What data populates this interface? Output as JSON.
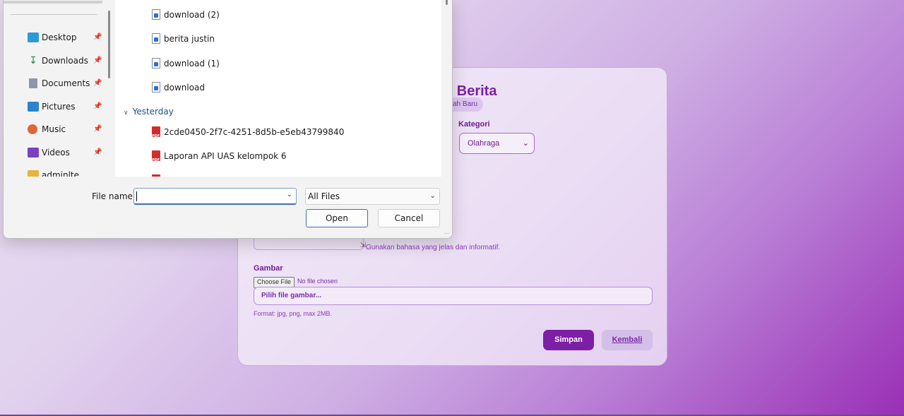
{
  "form": {
    "title": "n Berita",
    "badge": "ah Baru",
    "kategori_label": "Kategori",
    "kategori_value": "Olahraga",
    "konten_help": "Gunakan bahasa yang jelas dan informatif.",
    "gambar_label": "Gambar",
    "choose_file_label": "Choose File",
    "no_file_text": "No file chosen",
    "file_placeholder": "Pilih file gambar...",
    "format_help": "Format: jpg, png, max 2MB.",
    "save_label": "Simpan",
    "back_label": "Kembali"
  },
  "dialog": {
    "sidebar": {
      "items": [
        {
          "label": "Desktop",
          "icon": "desktop-icon",
          "color": "#2f9bd6"
        },
        {
          "label": "Downloads",
          "icon": "download-arrow-icon",
          "color": "#1f8a4c"
        },
        {
          "label": "Documents",
          "icon": "documents-icon",
          "color": "#6f7f95"
        },
        {
          "label": "Pictures",
          "icon": "pictures-icon",
          "color": "#2a84d2"
        },
        {
          "label": "Music",
          "icon": "music-icon",
          "color": "#e0663a"
        },
        {
          "label": "Videos",
          "icon": "videos-icon",
          "color": "#7a3fc2"
        },
        {
          "label": "adminlte",
          "icon": "folder-icon",
          "color": "#e8b33a"
        }
      ]
    },
    "files": [
      {
        "name": "download (2)",
        "type": "doc"
      },
      {
        "name": "berita justin",
        "type": "doc"
      },
      {
        "name": "download (1)",
        "type": "doc"
      },
      {
        "name": "download",
        "type": "doc"
      }
    ],
    "group_yesterday": "Yesterday",
    "yesterday_files": [
      {
        "name": "2cde0450-2f7c-4251-8d5b-e5eb43799840",
        "type": "pdf"
      },
      {
        "name": "Laporan API UAS kelompok 6",
        "type": "pdf"
      }
    ],
    "filename_label": "File name:",
    "filename_value": "",
    "filter_value": "All Files",
    "open_label": "Open",
    "cancel_label": "Cancel"
  }
}
